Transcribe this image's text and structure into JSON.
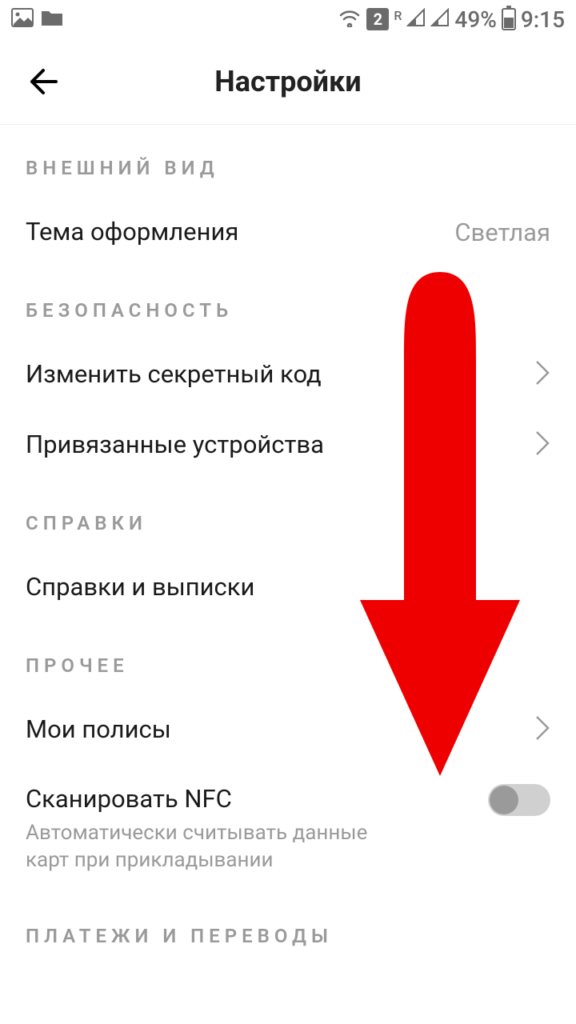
{
  "status": {
    "sim": "2",
    "roam": "R",
    "battery": "49%",
    "time": "9:15"
  },
  "header": {
    "title": "Настройки"
  },
  "sections": {
    "appearance": {
      "title": "ВНЕШНИЙ ВИД",
      "theme_label": "Тема оформления",
      "theme_value": "Светлая"
    },
    "security": {
      "title": "БЕЗОПАСНОСТЬ",
      "change_code": "Изменить секретный код",
      "devices": "Привязанные устройства"
    },
    "references": {
      "title": "СПРАВКИ",
      "statements": "Справки и выписки"
    },
    "other": {
      "title": "ПРОЧЕЕ",
      "policies": "Мои полисы",
      "nfc_label": "Сканировать NFC",
      "nfc_sub": "Автоматически считывать данные карт при прикладывании"
    },
    "payments": {
      "title": "ПЛАТЕЖИ И ПЕРЕВОДЫ"
    }
  }
}
